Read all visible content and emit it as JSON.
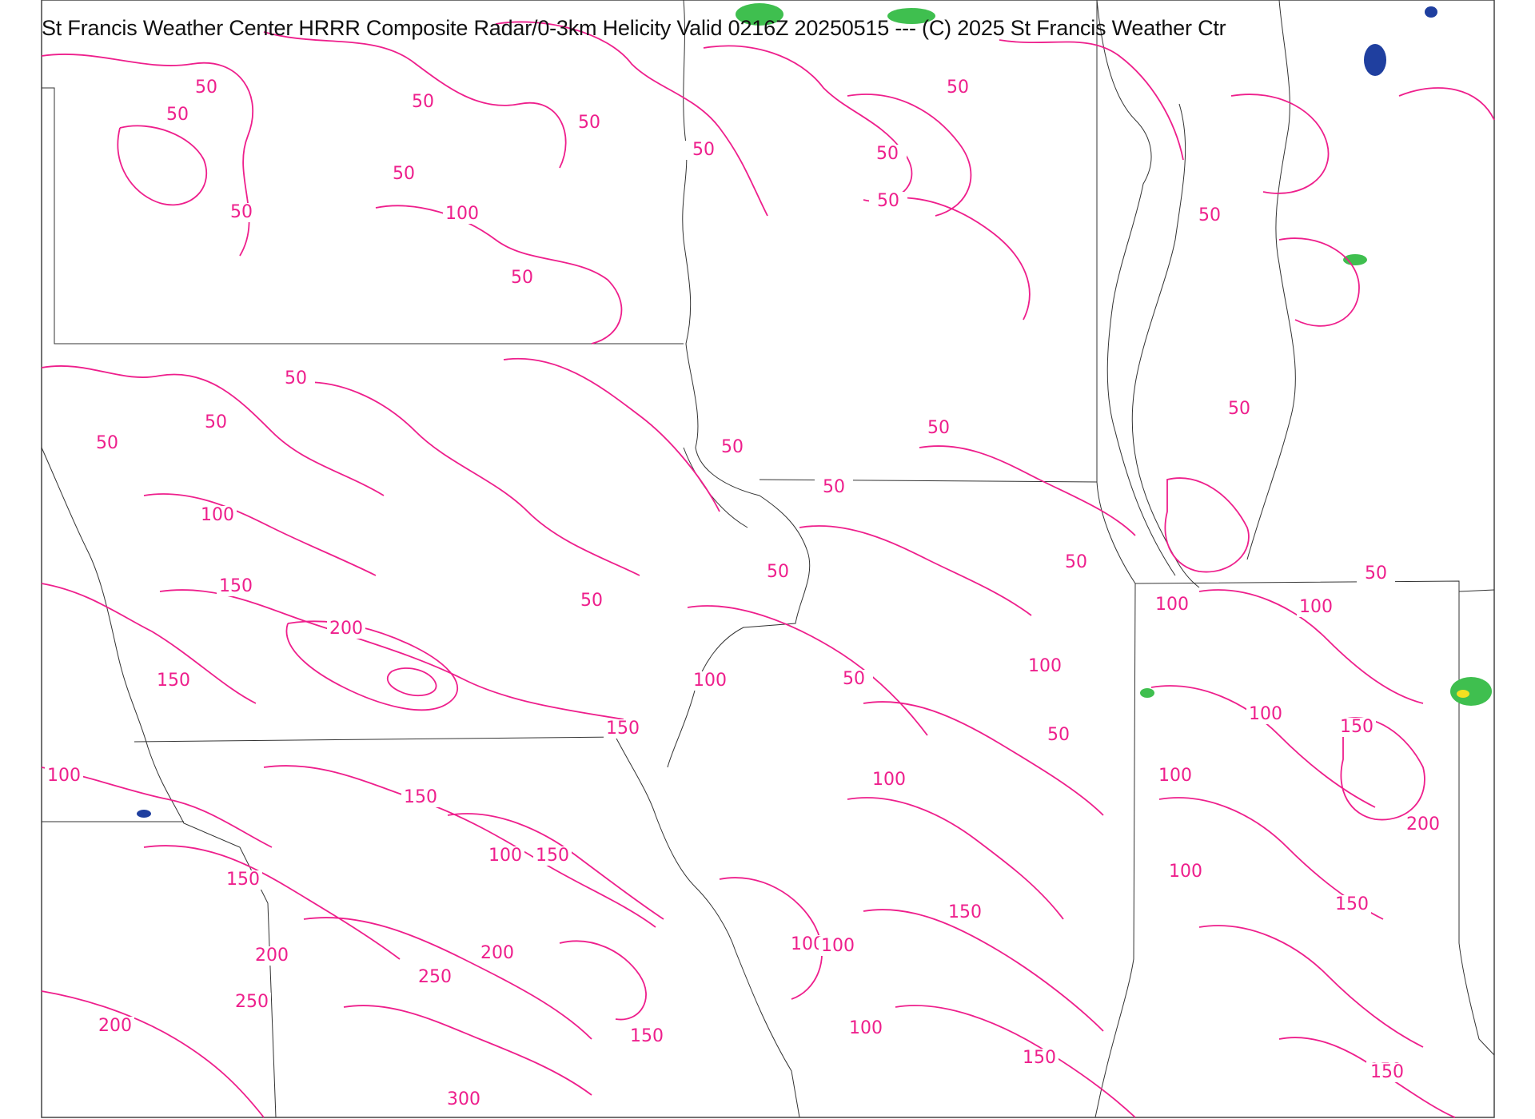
{
  "title": "St Francis Weather Center HRRR Composite Radar/0-3km Helicity  Valid  0216Z 20250515  --- (C) 2025 St Francis Weather Ctr",
  "colors": {
    "contour": "#ee1f8c",
    "border": "#333333",
    "background": "#ffffff",
    "radar_light": "#3fbf4f",
    "radar_dark": "#1f3f9f",
    "radar_heavy": "#f3e021"
  },
  "contour_labels": [
    "50",
    "50",
    "50",
    "50",
    "50",
    "50",
    "50",
    "50",
    "50",
    "50",
    "50",
    "50",
    "50",
    "50",
    "100",
    "50",
    "50",
    "50",
    "50",
    "50",
    "50",
    "50",
    "50",
    "50",
    "50",
    "100",
    "150",
    "100",
    "200",
    "100",
    "150",
    "150",
    "100",
    "50",
    "100",
    "100",
    "150",
    "100",
    "150",
    "200",
    "100",
    "100",
    "150",
    "150",
    "100",
    "150",
    "100",
    "100",
    "150",
    "100",
    "200",
    "250",
    "250",
    "200",
    "200",
    "150",
    "100",
    "150",
    "300",
    "150",
    "150"
  ]
}
